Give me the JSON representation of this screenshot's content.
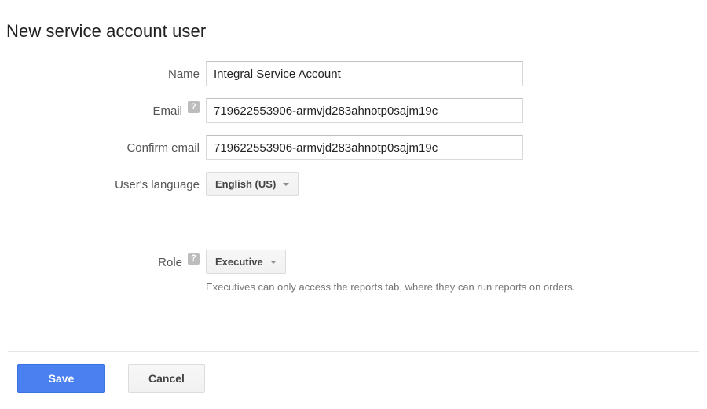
{
  "page": {
    "title": "New service account user"
  },
  "form": {
    "name": {
      "label": "Name",
      "value": "Integral Service Account",
      "placeholder": ""
    },
    "email": {
      "label": "Email",
      "help_icon": "help-icon",
      "value": "719622553906-armvjd283ahnotp0sajm19c",
      "placeholder": ""
    },
    "confirm_email": {
      "label": "Confirm email",
      "value": "719622553906-armvjd283ahnotp0sajm19c",
      "placeholder": ""
    },
    "language": {
      "label": "User's language",
      "selected": "English (US)",
      "caret_icon": "chevron-down-icon"
    },
    "role": {
      "label": "Role",
      "help_icon": "help-icon",
      "selected": "Executive",
      "caret_icon": "chevron-down-icon",
      "description": "Executives can only access the reports tab, where they can run reports on orders."
    }
  },
  "actions": {
    "save_label": "Save",
    "cancel_label": "Cancel"
  },
  "colors": {
    "primary": "#4a80f0",
    "label_text": "#555555",
    "helper_text": "#757575",
    "help_badge": "#bdbdbd",
    "input_border": "#d9d9d9",
    "divider": "#e5e5e5"
  }
}
